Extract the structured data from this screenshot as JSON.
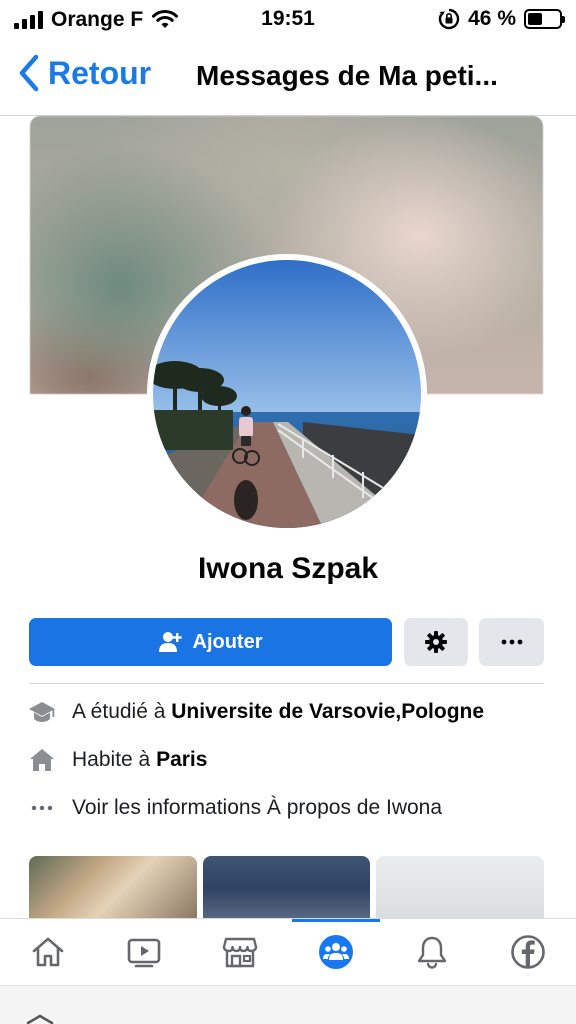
{
  "status_bar": {
    "carrier": "Orange F",
    "time": "19:51",
    "battery_percent": "46 %",
    "battery_level": 0.46,
    "icons": [
      "signal-icon",
      "wifi-icon",
      "rotation-lock-icon",
      "battery-icon"
    ]
  },
  "nav": {
    "back_label": "Retour",
    "title": "Messages de Ma peti..."
  },
  "profile": {
    "name": "Iwona Szpak",
    "add_label": "Ajouter",
    "info": {
      "studied_prefix": "A étudié à ",
      "studied_place": "Universite de Varsovie,Pologne",
      "lives_prefix": "Habite à ",
      "lives_place": "Paris",
      "about_label": "Voir les informations À propos de Iwona"
    }
  },
  "tabs": [
    {
      "icon": "home-icon",
      "active": false
    },
    {
      "icon": "video-icon",
      "active": false
    },
    {
      "icon": "marketplace-icon",
      "active": false
    },
    {
      "icon": "groups-icon",
      "active": true
    },
    {
      "icon": "bell-icon",
      "active": false
    },
    {
      "icon": "facebook-icon",
      "active": false
    }
  ],
  "colors": {
    "accent": "#1877f2",
    "button_primary": "#1b74e4",
    "button_secondary": "#e4e6eb"
  }
}
